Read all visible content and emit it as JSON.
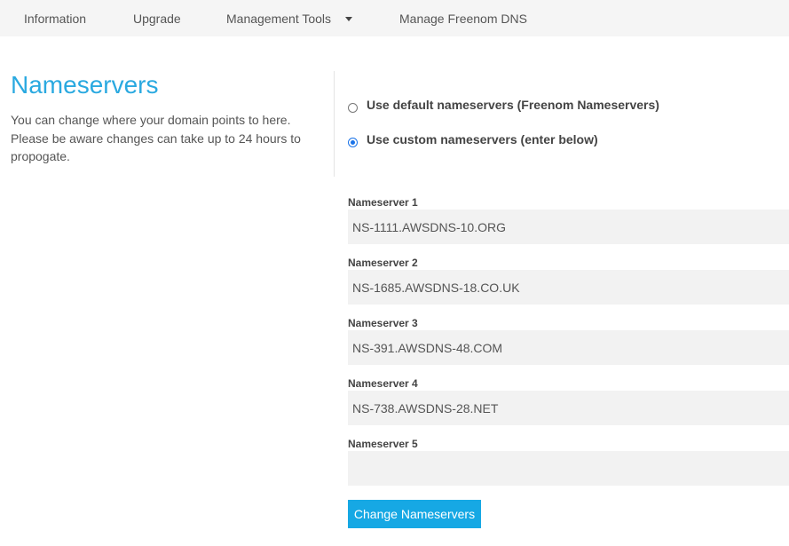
{
  "nav": {
    "items": [
      {
        "label": "Information"
      },
      {
        "label": "Upgrade"
      },
      {
        "label": "Management Tools"
      },
      {
        "label": "Manage Freenom DNS"
      }
    ]
  },
  "section": {
    "title": "Nameservers",
    "description": "You can change where your domain points to here. Please be aware changes can take up to 24 hours to propogate."
  },
  "options": {
    "default_label": "Use default nameservers (Freenom Nameservers)",
    "custom_label": "Use custom nameservers (enter below)",
    "selected": "custom"
  },
  "nameservers": [
    {
      "label": "Nameserver 1",
      "value": "NS-1111.AWSDNS-10.ORG"
    },
    {
      "label": "Nameserver 2",
      "value": "NS-1685.AWSDNS-18.CO.UK"
    },
    {
      "label": "Nameserver 3",
      "value": "NS-391.AWSDNS-48.COM"
    },
    {
      "label": "Nameserver 4",
      "value": "NS-738.AWSDNS-28.NET"
    },
    {
      "label": "Nameserver 5",
      "value": ""
    }
  ],
  "submit_label": "Change Nameservers",
  "colors": {
    "accent": "#2aa9e0",
    "button": "#16a8e4",
    "nav_bg": "#f5f5f5",
    "input_bg": "#f2f2f2"
  }
}
